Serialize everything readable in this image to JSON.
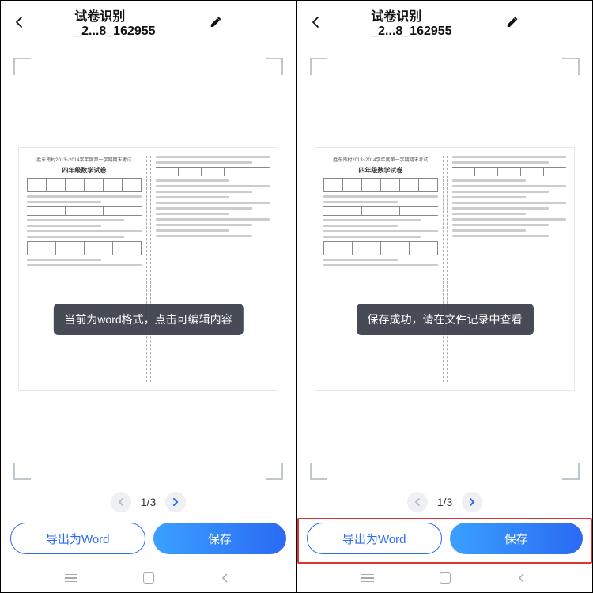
{
  "panes": [
    {
      "title": "试卷识别_2...8_162955",
      "toast": "当前为word格式，点击可编辑内容",
      "page_indicator": "1/3",
      "export_label": "导出为Word",
      "save_label": "保存",
      "highlight_actions": false
    },
    {
      "title": "试卷识别_2...8_162955",
      "toast": "保存成功，请在文件记录中查看",
      "page_indicator": "1/3",
      "export_label": "导出为Word",
      "save_label": "保存",
      "highlight_actions": true
    }
  ],
  "doc_preview": {
    "header_small": "胜东南村2013~2014学年度第一学期期末考试",
    "title": "四年级数学试卷"
  }
}
